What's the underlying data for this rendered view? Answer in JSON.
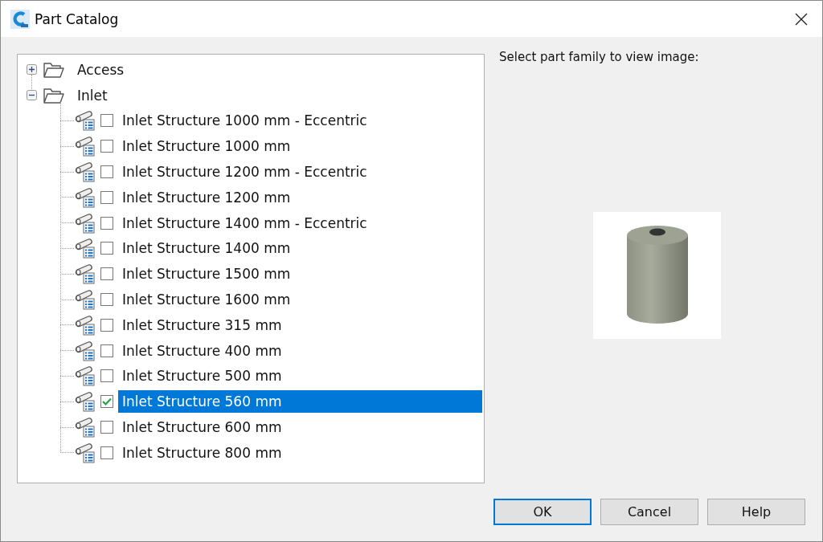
{
  "window": {
    "title": "Part Catalog"
  },
  "tree": [
    {
      "label": "Access",
      "expanded": false
    },
    {
      "label": "Inlet",
      "expanded": true,
      "children": [
        {
          "label": "Inlet Structure 1000 mm - Eccentric",
          "checked": false,
          "selected": false
        },
        {
          "label": "Inlet Structure 1000 mm",
          "checked": false,
          "selected": false
        },
        {
          "label": "Inlet Structure 1200 mm - Eccentric",
          "checked": false,
          "selected": false
        },
        {
          "label": "Inlet Structure 1200 mm",
          "checked": false,
          "selected": false
        },
        {
          "label": "Inlet Structure 1400 mm - Eccentric",
          "checked": false,
          "selected": false
        },
        {
          "label": "Inlet Structure 1400 mm",
          "checked": false,
          "selected": false
        },
        {
          "label": "Inlet Structure 1500 mm",
          "checked": false,
          "selected": false
        },
        {
          "label": "Inlet Structure 1600 mm",
          "checked": false,
          "selected": false
        },
        {
          "label": "Inlet Structure 315 mm",
          "checked": false,
          "selected": false
        },
        {
          "label": "Inlet Structure 400 mm",
          "checked": false,
          "selected": false
        },
        {
          "label": "Inlet Structure 500 mm",
          "checked": false,
          "selected": false
        },
        {
          "label": "Inlet Structure 560 mm",
          "checked": true,
          "selected": true
        },
        {
          "label": "Inlet Structure 600 mm",
          "checked": false,
          "selected": false
        },
        {
          "label": "Inlet Structure 800 mm",
          "checked": false,
          "selected": false
        }
      ]
    }
  ],
  "preview": {
    "label": "Select part family to view image:"
  },
  "buttons": [
    {
      "label": "OK",
      "default": true
    },
    {
      "label": "Cancel",
      "default": false
    },
    {
      "label": "Help",
      "default": false
    }
  ]
}
